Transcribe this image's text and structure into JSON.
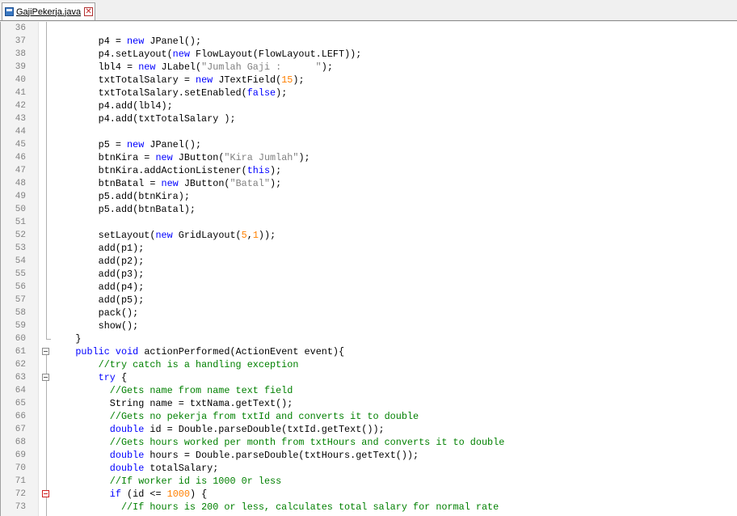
{
  "tab": {
    "title": "GajiPekerja.java",
    "close_glyph": "✕"
  },
  "editor": {
    "lines": [
      {
        "n": "36",
        "t": [
          [
            "",
            ""
          ]
        ]
      },
      {
        "n": "37",
        "t": [
          [
            "",
            "        p4 = "
          ],
          [
            "k",
            "new"
          ],
          [
            "",
            " JPanel();"
          ]
        ]
      },
      {
        "n": "38",
        "t": [
          [
            "",
            "        p4.setLayout("
          ],
          [
            "k",
            "new"
          ],
          [
            "",
            " FlowLayout(FlowLayout.LEFT));"
          ]
        ]
      },
      {
        "n": "39",
        "t": [
          [
            "",
            "        lbl4 = "
          ],
          [
            "k",
            "new"
          ],
          [
            "",
            " JLabel("
          ],
          [
            "s",
            "\"Jumlah Gaji :      \""
          ],
          [
            "",
            ");"
          ]
        ]
      },
      {
        "n": "40",
        "t": [
          [
            "",
            "        txtTotalSalary = "
          ],
          [
            "k",
            "new"
          ],
          [
            "",
            " JTextField("
          ],
          [
            "n",
            "15"
          ],
          [
            "",
            ");"
          ]
        ]
      },
      {
        "n": "41",
        "t": [
          [
            "",
            "        txtTotalSalary.setEnabled("
          ],
          [
            "k",
            "false"
          ],
          [
            "",
            ");"
          ]
        ]
      },
      {
        "n": "42",
        "t": [
          [
            "",
            "        p4.add(lbl4);"
          ]
        ]
      },
      {
        "n": "43",
        "t": [
          [
            "",
            "        p4.add(txtTotalSalary );"
          ]
        ]
      },
      {
        "n": "44",
        "t": [
          [
            "",
            ""
          ]
        ]
      },
      {
        "n": "45",
        "t": [
          [
            "",
            "        p5 = "
          ],
          [
            "k",
            "new"
          ],
          [
            "",
            " JPanel();"
          ]
        ]
      },
      {
        "n": "46",
        "t": [
          [
            "",
            "        btnKira = "
          ],
          [
            "k",
            "new"
          ],
          [
            "",
            " JButton("
          ],
          [
            "s",
            "\"Kira Jumlah\""
          ],
          [
            "",
            ");"
          ]
        ]
      },
      {
        "n": "47",
        "t": [
          [
            "",
            "        btnKira.addActionListener("
          ],
          [
            "k",
            "this"
          ],
          [
            "",
            ");"
          ]
        ]
      },
      {
        "n": "48",
        "t": [
          [
            "",
            "        btnBatal = "
          ],
          [
            "k",
            "new"
          ],
          [
            "",
            " JButton("
          ],
          [
            "s",
            "\"Batal\""
          ],
          [
            "",
            ");"
          ]
        ]
      },
      {
        "n": "49",
        "t": [
          [
            "",
            "        p5.add(btnKira);"
          ]
        ]
      },
      {
        "n": "50",
        "t": [
          [
            "",
            "        p5.add(btnBatal);"
          ]
        ]
      },
      {
        "n": "51",
        "t": [
          [
            "",
            ""
          ]
        ]
      },
      {
        "n": "52",
        "t": [
          [
            "",
            "        setLayout("
          ],
          [
            "k",
            "new"
          ],
          [
            "",
            " GridLayout("
          ],
          [
            "n",
            "5"
          ],
          [
            "",
            ","
          ],
          [
            "n",
            "1"
          ],
          [
            "",
            "));"
          ]
        ]
      },
      {
        "n": "53",
        "t": [
          [
            "",
            "        add(p1);"
          ]
        ]
      },
      {
        "n": "54",
        "t": [
          [
            "",
            "        add(p2);"
          ]
        ]
      },
      {
        "n": "55",
        "t": [
          [
            "",
            "        add(p3);"
          ]
        ]
      },
      {
        "n": "56",
        "t": [
          [
            "",
            "        add(p4);"
          ]
        ]
      },
      {
        "n": "57",
        "t": [
          [
            "",
            "        add(p5);"
          ]
        ]
      },
      {
        "n": "58",
        "t": [
          [
            "",
            "        pack();"
          ]
        ]
      },
      {
        "n": "59",
        "t": [
          [
            "",
            "        show();"
          ]
        ]
      },
      {
        "n": "60",
        "t": [
          [
            "",
            "    }"
          ]
        ]
      },
      {
        "n": "61",
        "t": [
          [
            "",
            "    "
          ],
          [
            "k",
            "public"
          ],
          [
            "",
            " "
          ],
          [
            "k",
            "void"
          ],
          [
            "",
            " actionPerformed(ActionEvent event){"
          ]
        ]
      },
      {
        "n": "62",
        "t": [
          [
            "",
            "        "
          ],
          [
            "c",
            "//try catch is a handling exception"
          ]
        ]
      },
      {
        "n": "63",
        "t": [
          [
            "",
            "        "
          ],
          [
            "k",
            "try"
          ],
          [
            "",
            " {"
          ]
        ]
      },
      {
        "n": "64",
        "t": [
          [
            "",
            "          "
          ],
          [
            "c",
            "//Gets name from name text field"
          ]
        ]
      },
      {
        "n": "65",
        "t": [
          [
            "",
            "          String name = txtNama.getText();"
          ]
        ]
      },
      {
        "n": "66",
        "t": [
          [
            "",
            "          "
          ],
          [
            "c",
            "//Gets no pekerja from txtId and converts it to double"
          ]
        ]
      },
      {
        "n": "67",
        "t": [
          [
            "",
            "          "
          ],
          [
            "k",
            "double"
          ],
          [
            "",
            " id = Double.parseDouble(txtId.getText());"
          ]
        ]
      },
      {
        "n": "68",
        "t": [
          [
            "",
            "          "
          ],
          [
            "c",
            "//Gets hours worked per month from txtHours and converts it to double"
          ]
        ]
      },
      {
        "n": "69",
        "t": [
          [
            "",
            "          "
          ],
          [
            "k",
            "double"
          ],
          [
            "",
            " hours = Double.parseDouble(txtHours.getText());"
          ]
        ]
      },
      {
        "n": "70",
        "t": [
          [
            "",
            "          "
          ],
          [
            "k",
            "double"
          ],
          [
            "",
            " totalSalary;"
          ]
        ]
      },
      {
        "n": "71",
        "t": [
          [
            "",
            "          "
          ],
          [
            "c",
            "//If worker id is 1000 0r less"
          ]
        ]
      },
      {
        "n": "72",
        "t": [
          [
            "",
            "          "
          ],
          [
            "k",
            "if"
          ],
          [
            "",
            " (id <= "
          ],
          [
            "n",
            "1000"
          ],
          [
            "",
            ") {"
          ]
        ]
      },
      {
        "n": "73",
        "t": [
          [
            "",
            "            "
          ],
          [
            "c",
            "//If hours is 200 or less, calculates total salary for normal rate"
          ]
        ]
      }
    ]
  },
  "colors": {
    "keyword": "#0000ff",
    "string": "#808080",
    "number": "#ff8000",
    "comment": "#008000",
    "linenumber": "#808080"
  },
  "icons": {
    "file": "java-file-icon",
    "close": "close-icon",
    "fold": "fold-collapse-icon"
  }
}
